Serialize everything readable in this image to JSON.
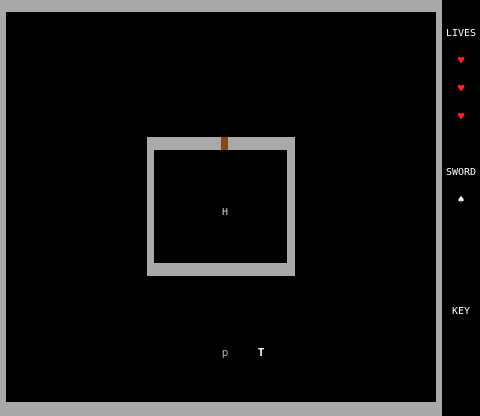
{
  "hud": {
    "lives_label": "LIVES",
    "lives_count": 3,
    "heart_glyph": "♥",
    "heart_color": "#ff2020",
    "sword_label": "SWORD",
    "sword_glyph": "♠",
    "key_label": "KEY"
  },
  "map": {
    "wall_color": "#a9a9a9",
    "floor_color": "#000000",
    "door_color": "#8b4513"
  },
  "entities": {
    "hole_glyph": "H",
    "player_glyph": "p",
    "player_color": "#d2a070",
    "treasure_glyph": "T"
  }
}
